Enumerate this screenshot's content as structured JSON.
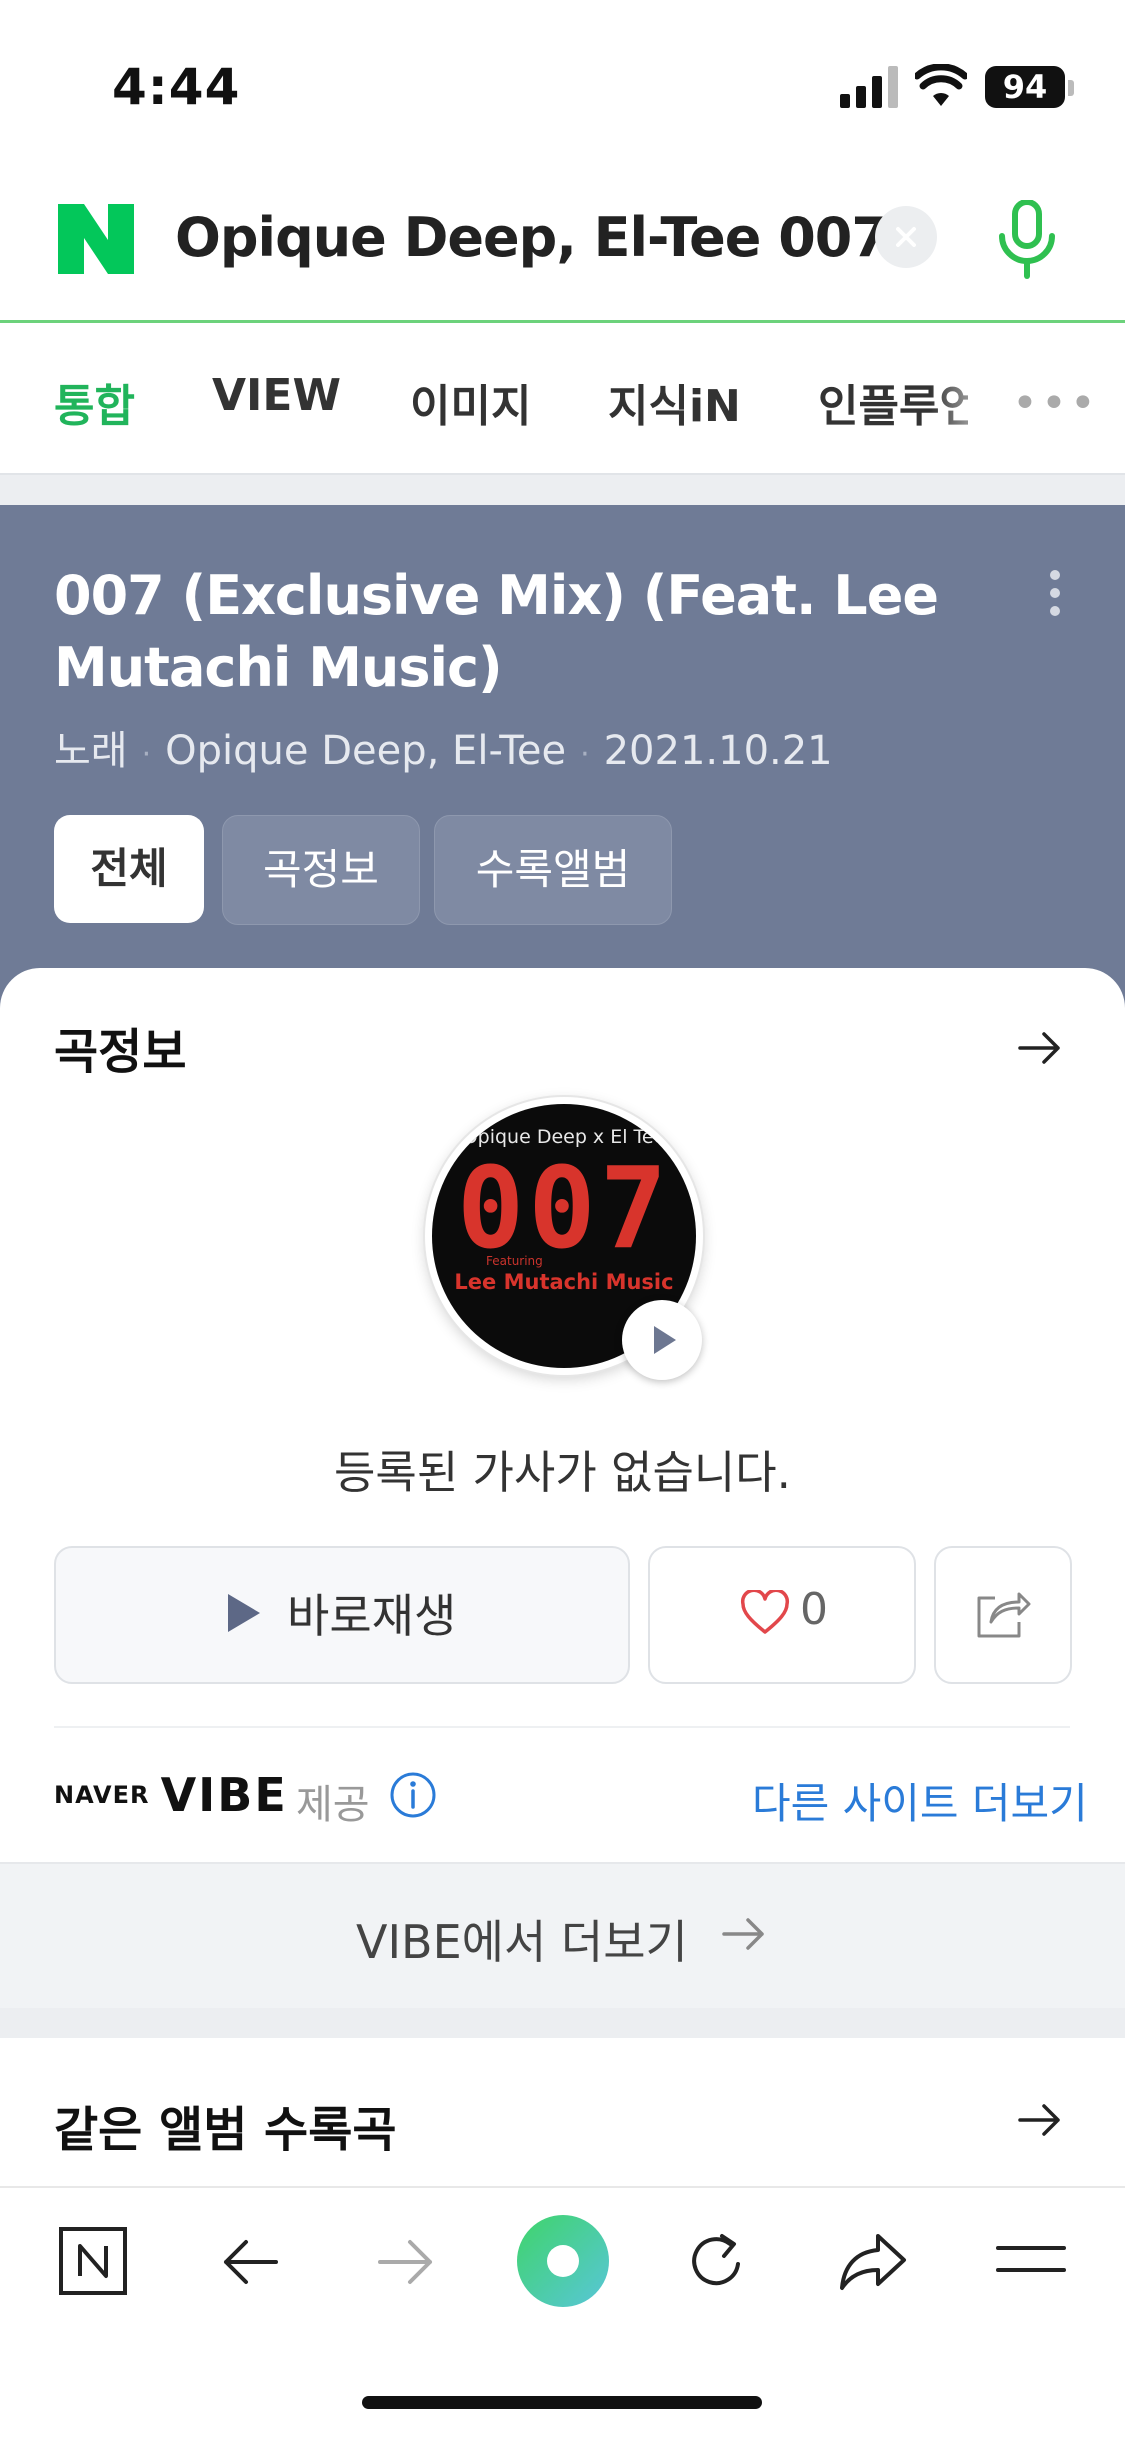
{
  "status_bar": {
    "time": "4:44",
    "battery": "94"
  },
  "search": {
    "query": "Opique Deep, El-Tee 007"
  },
  "tabs": [
    {
      "label": "통합",
      "active": true
    },
    {
      "label": "VIEW",
      "active": false
    },
    {
      "label": "이미지",
      "active": false
    },
    {
      "label": "지식iN",
      "active": false
    },
    {
      "label": "인플루언",
      "active": false
    }
  ],
  "song": {
    "title": "007 (Exclusive Mix) (Feat. Lee Mutachi Music)",
    "type": "노래",
    "artist": "Opique Deep, El-Tee",
    "date": "2021.10.21",
    "filters": [
      "전체",
      "곡정보",
      "수록앨범"
    ]
  },
  "song_info": {
    "heading": "곡정보",
    "album_art": {
      "top_text": "Opique Deep x El Tee",
      "number": "007",
      "featuring": "Featuring",
      "feat_name": "Lee Mutachi Music"
    },
    "lyrics_text": "등록된 가사가 없습니다.",
    "play_label": "바로재생",
    "like_count": "0",
    "provider_brand_small": "NAVER",
    "provider_brand": "VIBE",
    "provider_label": "제공",
    "more_sites": "다른 사이트 더보기",
    "vibe_more": "VIBE에서 더보기"
  },
  "same_album": {
    "heading": "같은 앨범 수록곡"
  },
  "colors": {
    "brand_green": "#03c75a",
    "header_bg": "#6f7b96",
    "link_blue": "#2a7bd8",
    "heart_red": "#e2474b"
  }
}
